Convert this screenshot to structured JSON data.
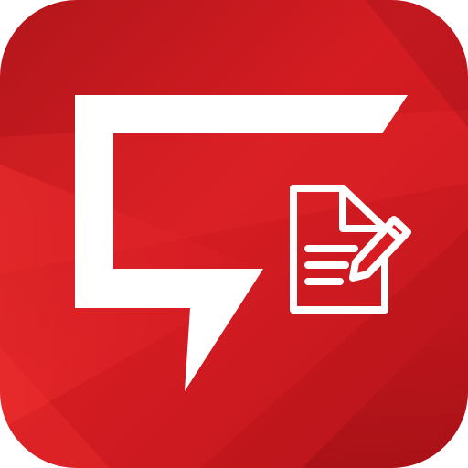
{
  "icon": {
    "name": "speech-bubble-document-edit-icon",
    "colors": {
      "base": "#d81c22",
      "base_dark": "#a8141a",
      "highlight": "#ee2a2e",
      "shadow": "#9c1015",
      "glyph": "#ffffff"
    }
  }
}
